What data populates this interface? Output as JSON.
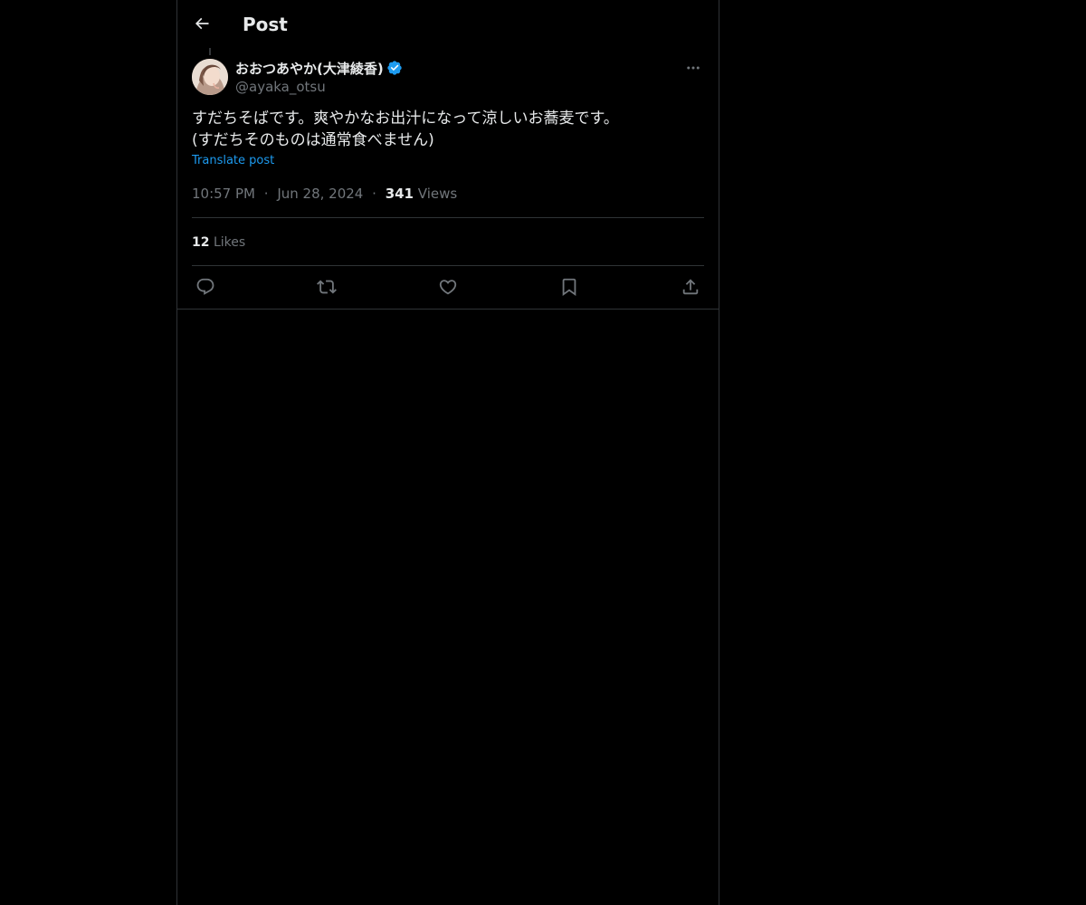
{
  "header": {
    "title": "Post",
    "back_icon": "arrow-left-icon"
  },
  "post": {
    "author": {
      "name": "おおつあやか(大津綾香)",
      "handle": "@ayaka_otsu",
      "verified": true,
      "verified_color": "#1d9bf0"
    },
    "text": "すだちそばです。爽やかなお出汁になって涼しいお蕎麦です。\n(すだちそのものは通常食べません)",
    "translate_label": "Translate post",
    "time": "10:57 PM",
    "separator": "·",
    "date": "Jun 28, 2024",
    "views_count": "341",
    "views_label": "Views",
    "likes_count": "12",
    "likes_label": "Likes"
  },
  "actions": [
    {
      "name": "reply",
      "icon": "reply-icon"
    },
    {
      "name": "repost",
      "icon": "repost-icon"
    },
    {
      "name": "like",
      "icon": "heart-icon"
    },
    {
      "name": "bookmark",
      "icon": "bookmark-icon"
    },
    {
      "name": "share",
      "icon": "share-icon"
    }
  ],
  "colors": {
    "background": "#000000",
    "text_primary": "#e7e9ea",
    "text_secondary": "#71767b",
    "accent": "#1d9bf0",
    "border": "#2f3336"
  }
}
